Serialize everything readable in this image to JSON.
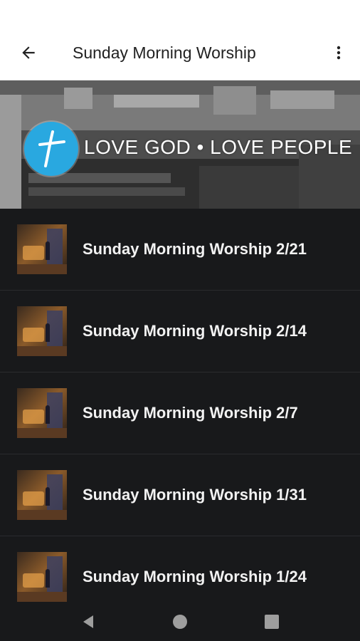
{
  "app_bar": {
    "title": "Sunday Morning Worship",
    "back_icon": "arrow-left-icon",
    "menu_icon": "more-vert-icon"
  },
  "banner": {
    "tagline": "LOVE GOD • LOVE PEOPLE",
    "logo_icon": "cross-logo-icon",
    "logo_color": "#29a8e0"
  },
  "list": {
    "items": [
      {
        "label": "Sunday Morning Worship 2/21"
      },
      {
        "label": "Sunday Morning Worship 2/14"
      },
      {
        "label": "Sunday Morning Worship 2/7"
      },
      {
        "label": "Sunday Morning Worship 1/31"
      },
      {
        "label": "Sunday Morning Worship 1/24"
      }
    ]
  },
  "nav_bar": {
    "back_icon": "nav-back-icon",
    "home_icon": "nav-home-icon",
    "recents_icon": "nav-recents-icon"
  },
  "colors": {
    "background": "#18191b",
    "app_bar": "#ffffff",
    "text_primary": "#f2f2f2"
  }
}
